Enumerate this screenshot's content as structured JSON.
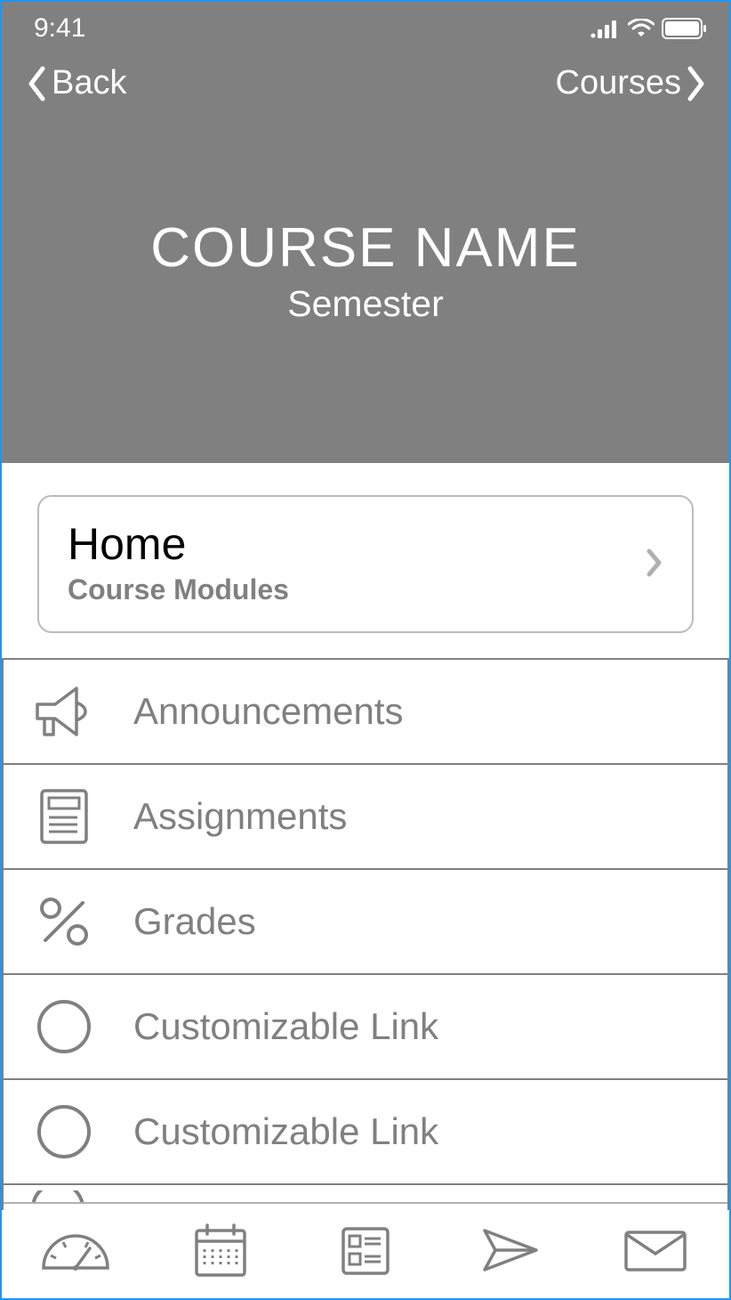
{
  "statusBar": {
    "time": "9:41"
  },
  "nav": {
    "back": "Back",
    "forward": "Courses"
  },
  "header": {
    "title": "COURSE NAME",
    "subtitle": "Semester"
  },
  "homeCard": {
    "title": "Home",
    "subtitle": "Course Modules"
  },
  "menu": {
    "items": [
      {
        "label": "Announcements",
        "icon": "megaphone"
      },
      {
        "label": "Assignments",
        "icon": "document"
      },
      {
        "label": "Grades",
        "icon": "percent"
      },
      {
        "label": "Customizable Link",
        "icon": "circle"
      },
      {
        "label": "Customizable Link",
        "icon": "circle"
      }
    ]
  }
}
